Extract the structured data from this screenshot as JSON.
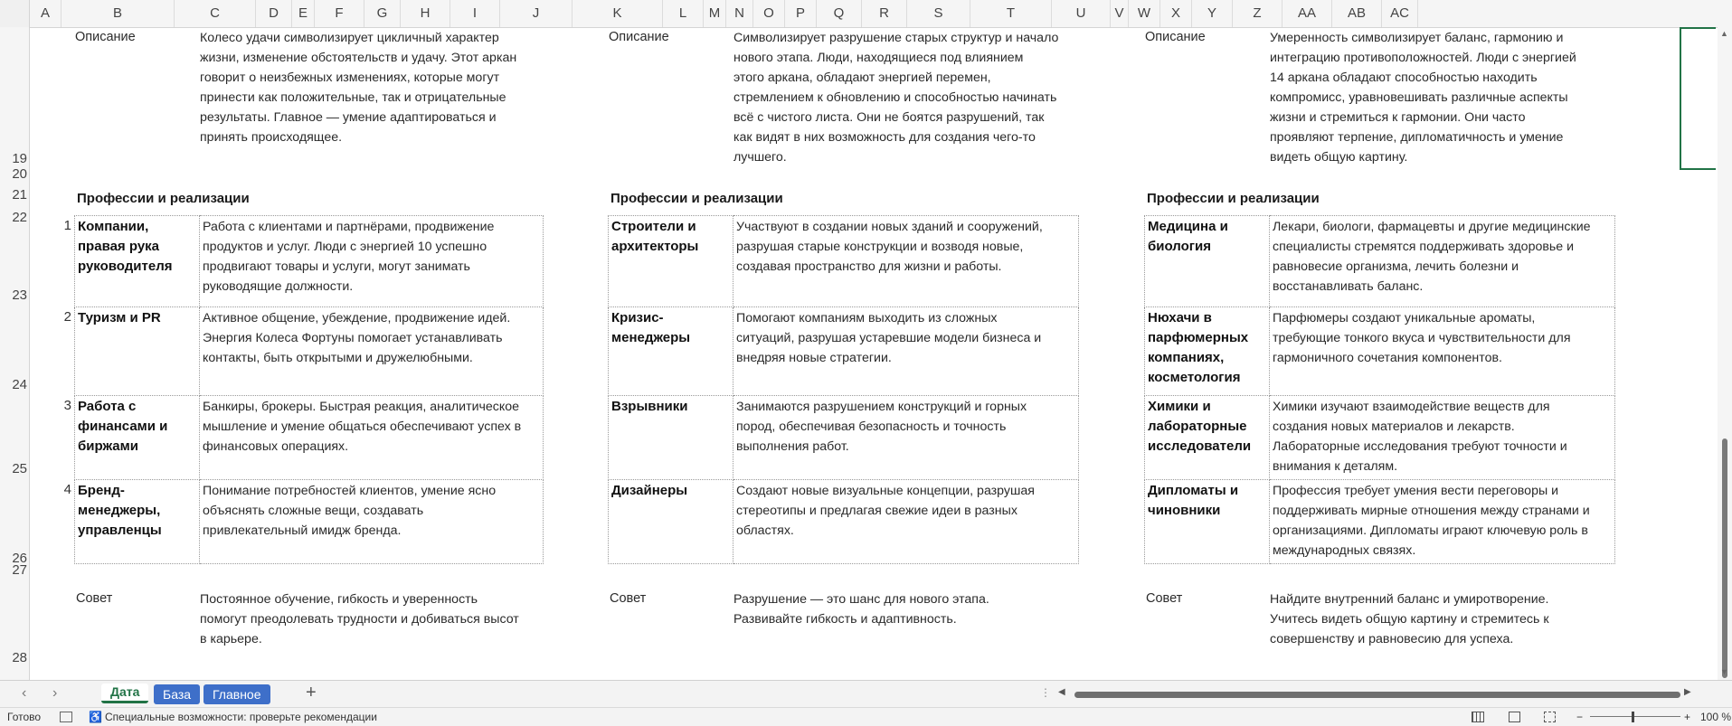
{
  "columns": [
    "A",
    "B",
    "C",
    "D",
    "E",
    "F",
    "G",
    "H",
    "I",
    "J",
    "K",
    "L",
    "M",
    "N",
    "O",
    "P",
    "Q",
    "R",
    "S",
    "T",
    "U",
    "V",
    "W",
    "X",
    "Y",
    "Z",
    "AA",
    "AB",
    "AC"
  ],
  "rows": [
    "19",
    "20",
    "21",
    "22",
    "23",
    "24",
    "25",
    "26",
    "27",
    "28"
  ],
  "blocks": [
    {
      "desc_label": "Описание",
      "desc_lines": [
        "Колесо удачи символизирует цикличный характер",
        "жизни, изменение обстоятельств и удачу. Этот аркан",
        "говорит о неизбежных изменениях, которые могут",
        "принести как положительные, так и отрицательные",
        "результаты. Главное — умение адаптироваться и",
        "принять происходящее."
      ],
      "section_title": "Профессии и реализации",
      "rows": [
        {
          "idx": "1",
          "name": [
            "Компании,",
            "правая рука",
            "руководителя"
          ],
          "text": [
            "Работа с клиентами и партнёрами, продвижение",
            "продуктов и услуг. Люди с энергией 10 успешно",
            "продвигают товары и услуги, могут занимать",
            "руководящие должности."
          ]
        },
        {
          "idx": "2",
          "name": [
            "Туризм и PR"
          ],
          "text": [
            "Активное общение, убеждение, продвижение идей.",
            "Энергия Колеса Фортуны помогает устанавливать",
            "контакты, быть открытыми и дружелюбными."
          ]
        },
        {
          "idx": "3",
          "name": [
            "Работа с",
            "финансами и",
            "биржами"
          ],
          "text": [
            "Банкиры, брокеры. Быстрая реакция, аналитическое",
            "мышление и умение общаться обеспечивают успех в",
            "финансовых операциях."
          ]
        },
        {
          "idx": "4",
          "name": [
            "Бренд-",
            "менеджеры,",
            "управленцы"
          ],
          "text": [
            "Понимание потребностей клиентов, умение ясно",
            "объяснять сложные вещи, создавать",
            "привлекательный имидж бренда."
          ]
        }
      ],
      "advice_label": "Совет",
      "advice_lines": [
        "Постоянное обучение, гибкость и уверенность",
        "помогут преодолевать трудности и добиваться высот",
        "в карьере."
      ]
    },
    {
      "desc_label": "Описание",
      "desc_lines": [
        "Символизирует разрушение старых структур и начало",
        "нового этапа. Люди, находящиеся под влиянием",
        "этого аркана, обладают энергией перемен,",
        "стремлением к обновлению и способностью начинать",
        "всё с чистого листа. Они не боятся разрушений, так",
        "как видят в них возможность для создания чего-то",
        "лучшего."
      ],
      "section_title": "Профессии и реализации",
      "rows": [
        {
          "idx": "",
          "name": [
            "Строители и",
            "архитекторы"
          ],
          "text": [
            "Участвуют в создании новых зданий и сооружений,",
            "разрушая старые конструкции и возводя новые,",
            "создавая пространство для жизни и работы."
          ]
        },
        {
          "idx": "",
          "name": [
            "Кризис-",
            "менеджеры"
          ],
          "text": [
            "Помогают компаниям выходить из сложных",
            "ситуаций, разрушая устаревшие модели бизнеса и",
            "внедряя новые стратегии."
          ]
        },
        {
          "idx": "",
          "name": [
            "Взрывники"
          ],
          "text": [
            "Занимаются разрушением конструкций и горных",
            "пород, обеспечивая безопасность и точность",
            "выполнения работ."
          ]
        },
        {
          "idx": "",
          "name": [
            "Дизайнеры"
          ],
          "text": [
            "Создают новые визуальные концепции, разрушая",
            "стереотипы и предлагая свежие идеи в разных",
            "областях."
          ]
        }
      ],
      "advice_label": "Совет",
      "advice_lines": [
        "Разрушение — это шанс для нового этапа.",
        "Развивайте гибкость и адаптивность."
      ]
    },
    {
      "desc_label": "Описание",
      "desc_lines": [
        "Умеренность символизирует баланс, гармонию и",
        "интеграцию противоположностей. Люди с энергией",
        "14 аркана обладают способностью находить",
        "компромисс, уравновешивать различные аспекты",
        "жизни и стремиться к гармонии. Они часто",
        "проявляют терпение, дипломатичность и умение",
        "видеть общую картину."
      ],
      "section_title": "Профессии и реализации",
      "rows": [
        {
          "idx": "",
          "name": [
            "Медицина и",
            "биология"
          ],
          "text": [
            "Лекари, биологи, фармацевты и другие медицинские",
            "специалисты стремятся поддерживать здоровье и",
            "равновесие организма, лечить болезни и",
            "восстанавливать баланс."
          ]
        },
        {
          "idx": "",
          "name": [
            "Нюхачи в",
            "парфюмерных",
            "компаниях,",
            "косметология"
          ],
          "text": [
            "Парфюмеры создают уникальные ароматы,",
            "требующие тонкого вкуса и чувствительности для",
            "гармоничного сочетания компонентов."
          ]
        },
        {
          "idx": "",
          "name": [
            "Химики и",
            "лабораторные",
            "исследователи"
          ],
          "text": [
            "Химики изучают взаимодействие веществ для",
            "создания новых материалов и лекарств.",
            "Лабораторные исследования требуют точности и",
            "внимания к деталям."
          ]
        },
        {
          "idx": "",
          "name": [
            "Дипломаты и",
            "чиновники"
          ],
          "text": [
            "Профессия требует умения вести переговоры и",
            "поддерживать мирные отношения между странами и",
            "организациями. Дипломаты играют ключевую роль в",
            "международных связях."
          ]
        }
      ],
      "advice_label": "Совет",
      "advice_lines": [
        "Найдите внутренний баланс и умиротворение.",
        "Учитесь видеть общую картину и стремитесь к",
        "совершенству и равновесию для успеха."
      ]
    }
  ],
  "sheet_tabs": [
    {
      "label": "Дата",
      "active": true
    },
    {
      "label": "База",
      "active": false
    },
    {
      "label": "Главное",
      "active": false
    }
  ],
  "add_sheet": "+",
  "status": {
    "ready": "Готово",
    "accessibility": "Специальные возможности: проверьте рекомендации",
    "zoom": "100 %"
  },
  "icons": {
    "macro": "macro-icon",
    "accessibility": "accessibility-icon",
    "normal_view": "grid-view-icon",
    "page_layout": "page-layout-icon",
    "page_break": "page-break-icon"
  },
  "colors": {
    "accent": "#217346",
    "tab_blue": "#3e6fc9"
  }
}
